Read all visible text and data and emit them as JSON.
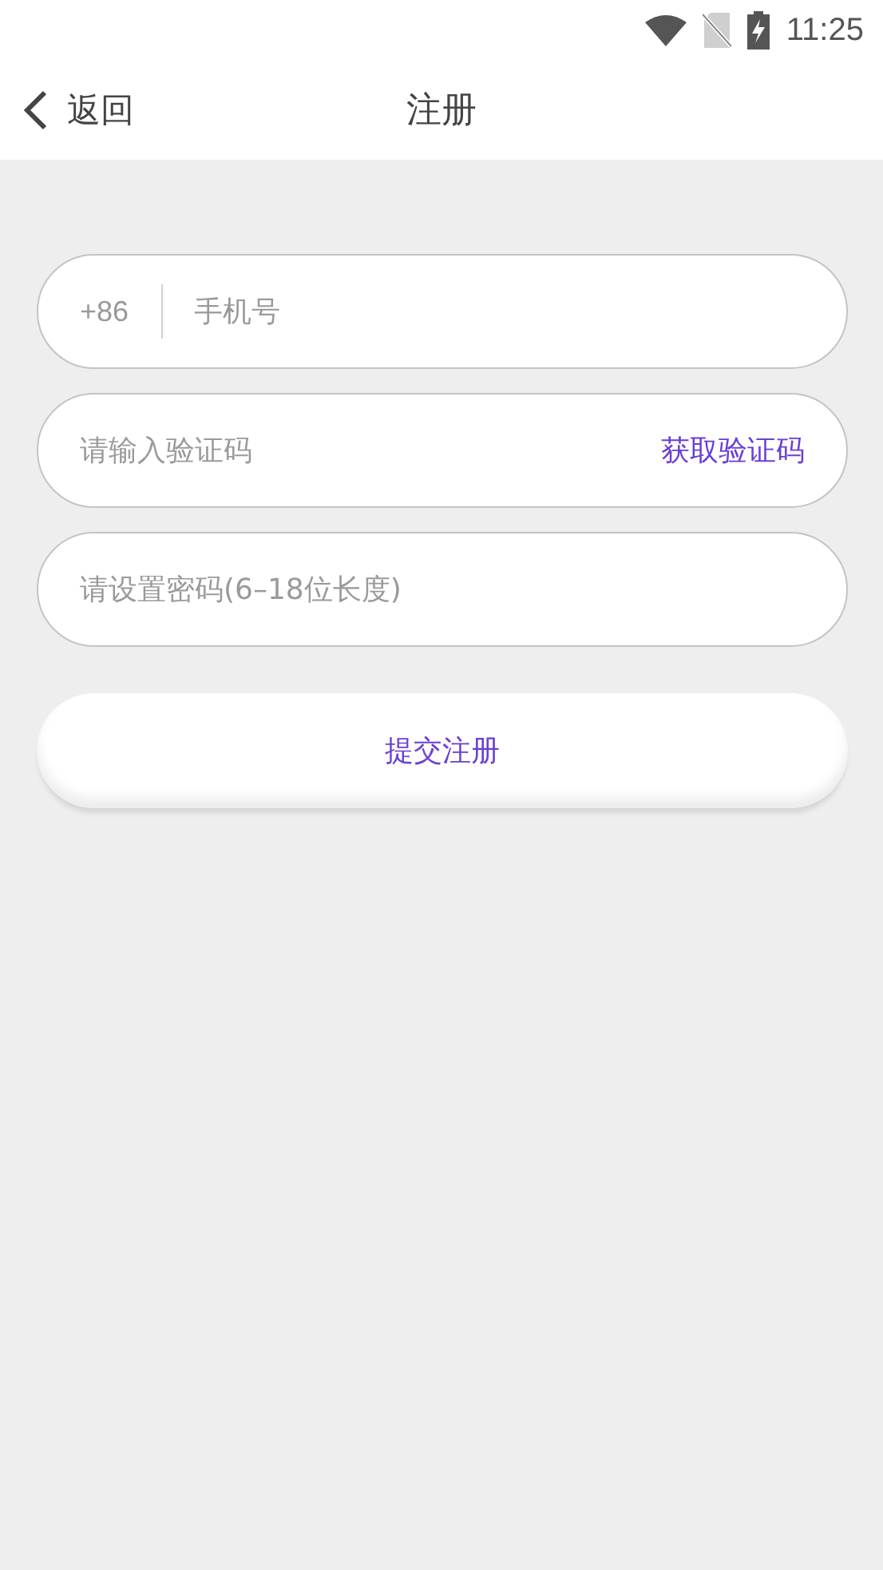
{
  "status_bar": {
    "time": "11:25"
  },
  "header": {
    "back_label": "返回",
    "title": "注册"
  },
  "fields": [
    {
      "kind": "phone",
      "prefix": "+86",
      "placeholder": "手机号"
    },
    {
      "kind": "code",
      "placeholder": "请输入验证码",
      "action": "获取验证码"
    },
    {
      "kind": "password",
      "placeholder": "请设置密码(6–18位长度)"
    }
  ],
  "submit": {
    "label": "提交注册"
  }
}
